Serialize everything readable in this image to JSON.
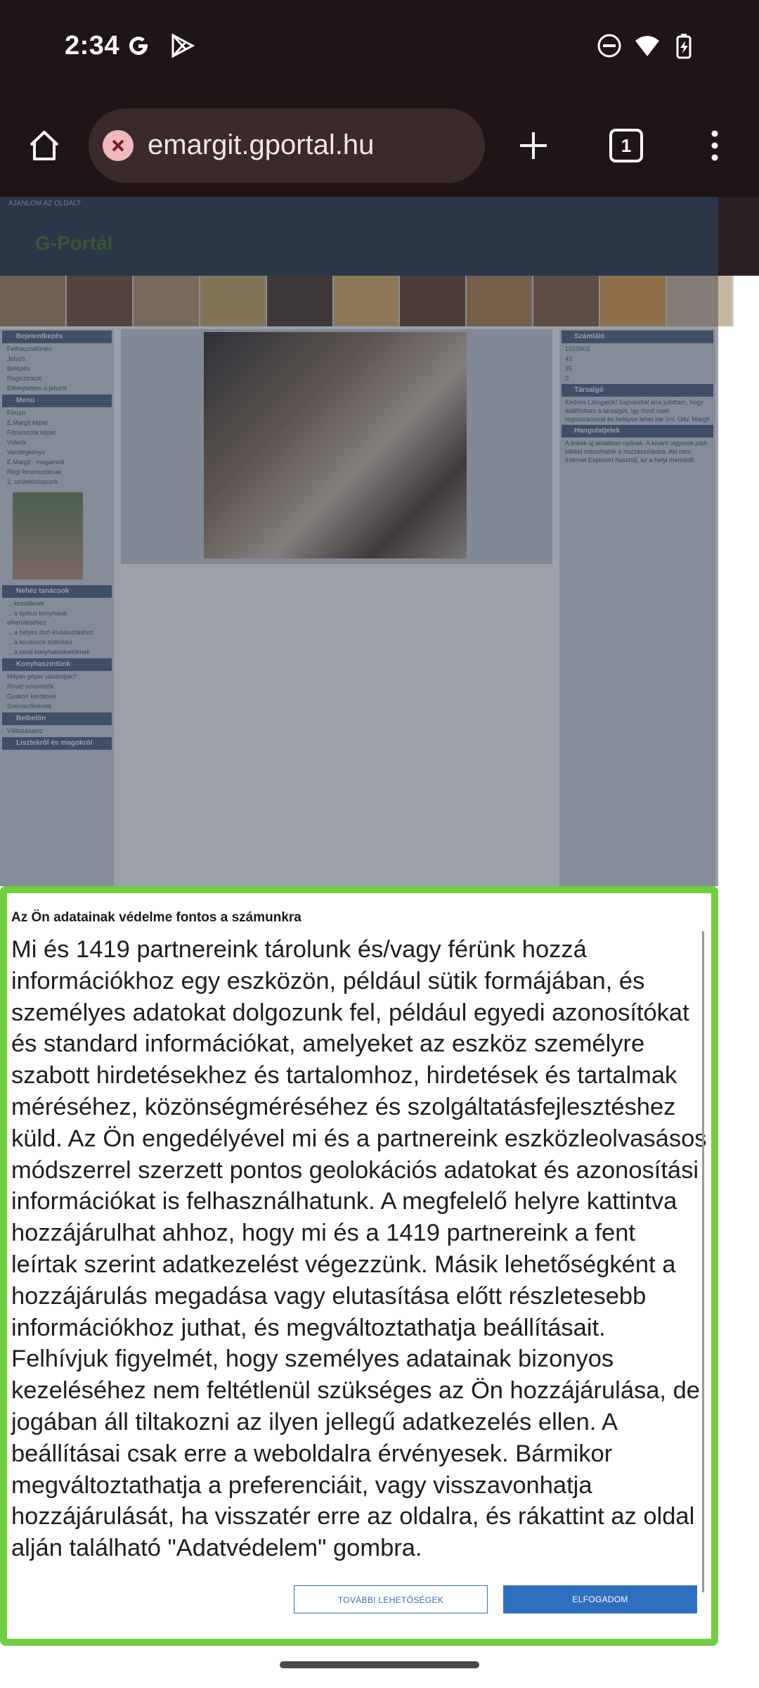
{
  "status_bar": {
    "time": "2:34",
    "left_icons": [
      "google-icon",
      "play-games-icon"
    ],
    "right_icons": [
      "do-not-disturb-icon",
      "wifi-icon",
      "battery-charging-icon"
    ]
  },
  "browser": {
    "url": "emargit.gportal.hu",
    "tab_count": "1",
    "icons": [
      "home-icon",
      "site-error-icon",
      "new-tab-icon",
      "tab-switcher-icon",
      "more-menu-icon"
    ]
  },
  "site": {
    "recommend_text": "AJÁNLOM AZ OLDALT",
    "logo_text": "G-Portál",
    "left_sections": [
      {
        "title": "Bejelentkezés",
        "lines": [
          "Felhasználónév:",
          "Jelszó:",
          "Belépés",
          "Regisztráció",
          "Elfelejtettem a jelszót"
        ]
      },
      {
        "title": "Menü",
        "lines": [
          "Fórum",
          "E.Margit képei",
          "Fórumozók képei",
          "Videók",
          "Vendégkönyv",
          "E.Margit - magamról",
          "Régi fórumozóknak",
          "2. születésnapunk"
        ]
      },
      {
        "title": "Nehéz tanácsok",
        "lines": [
          "... kezdőknek",
          "... a tipikus konyhaiak elkerüléséhez",
          "... a helyes liszt-kiválasztáshoz",
          "... a kovászos sütéshez",
          "... a pesti konyhakedvelőknek"
        ]
      },
      {
        "title": "Konyhaszintünk",
        "lines": [
          "Milyen gépet vásároljak?",
          "Rövid ismertetők",
          "Gyakori kérdések",
          "Szervezőinknek"
        ]
      },
      {
        "title": "Belbelőn",
        "lines": [
          "Változásainz"
        ]
      },
      {
        "title": "Lisztekről és magokról",
        "lines": []
      }
    ],
    "right_sections": [
      {
        "title": "Számláló",
        "lines": [
          "1010903",
          "43",
          "35",
          "0"
        ]
      },
      {
        "title": "Társalgó",
        "lines": [
          "Kedves Látogatók! Sajnálattal arra jutottam, hogy átállítottam a társalgót, így most csak regisztrációval és belépve lehet ide írni. Üdv. Margit"
        ]
      },
      {
        "title": "Hangulatjelek",
        "lines": [
          "A linkek új ablakban nyílnak. A kívánt vigyorok jobb klikkel másolhatók a hozzászólásba. Aki nem Internet Explorert használ, az a helyi menüből."
        ]
      }
    ]
  },
  "consent": {
    "heading": "Az Ön adatainak védelme fontos a számunkra",
    "body": "Mi és 1419 partnereink tárolunk és/vagy férünk hozzá információkhoz egy eszközön, például sütik formájában, és személyes adatokat dolgozunk fel, például egyedi azonosítókat és standard információkat, amelyeket az eszköz személyre szabott hirdetésekhez és tartalomhoz, hirdetések és tartalmak méréséhez, közönségméréséhez és szolgáltatásfejlesztéshez küld. Az Ön engedélyével mi és a partnereink eszközleolvasásos módszerrel szerzett pontos geolokációs adatokat és azonosítási információkat is felhasználhatunk. A megfelelő helyre kattintva hozzájárulhat ahhoz, hogy mi és a 1419 partnereink a fent leírtak szerint adatkezelést végezzünk. Másik lehetőségként a hozzájárulás megadása vagy elutasítása előtt részletesebb információkhoz juthat, és megváltoztathatja beállításait. Felhívjuk figyelmét, hogy személyes adatainak bizonyos kezeléséhez nem feltétlenül szükséges az Ön hozzájárulása, de jogában áll tiltakozni az ilyen jellegű adatkezelés ellen. A beállításai csak erre a weboldalra érvényesek. Bármikor megváltoztathatja a preferenciáit, vagy visszavonhatja hozzájárulását, ha visszatér erre az oldalra, és rákattint az oldal alján található \"Adatvédelem\" gombra.",
    "more_options_label": "TOVÁBBI LEHETŐSÉGEK",
    "accept_label": "ELFOGADOM",
    "accent_color": "#2f6fbf",
    "highlight_border_color": "#6fcf3f"
  }
}
